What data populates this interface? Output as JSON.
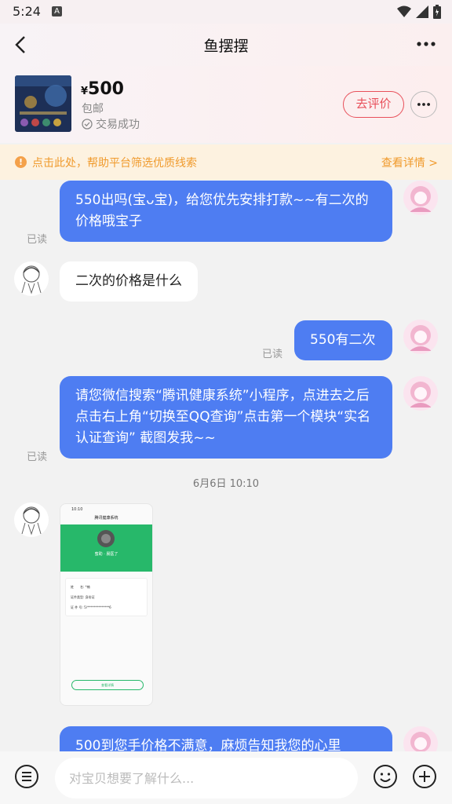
{
  "status": {
    "time": "5:24",
    "notif": "A"
  },
  "header": {
    "title": "鱼摆摆"
  },
  "product": {
    "currency": "¥",
    "price": "500",
    "shipping": "包邮",
    "deal_status": "交易成功",
    "rate_label": "去评价"
  },
  "tip": {
    "text": "点击此处，帮助平台筛选优质线索",
    "link": "查看详情 >"
  },
  "messages": [
    {
      "side": "out",
      "text": "550出吗(宝ᴗ宝)，给您优先安排打款~~有二次的价格哦宝子",
      "read": "已读"
    },
    {
      "side": "in",
      "text": "二次的价格是什么"
    },
    {
      "side": "out",
      "text": "550有二次",
      "read": "已读"
    },
    {
      "side": "out",
      "text": "请您微信搜索“腾讯健康系统”小程序，点进去之后点击右上角“切换至QQ查询”点击第一个模块“实名认证查询” 截图发我~~",
      "read": "已读"
    },
    {
      "side": "out",
      "text": "500到您手价格不满意，麻烦告知我您的心里"
    }
  ],
  "timestamp": "6月6日 10:10",
  "screenshot": {
    "time": "10:10",
    "title": "腾讯健康系统",
    "name_line": "蜜助 · 晨医了",
    "rows": [
      {
        "k": "姓　　名:",
        "v": "*楠"
      },
      {
        "k": "证件类型:",
        "v": "身份证"
      },
      {
        "k": "证 件 号:",
        "v": "5/**************6"
      }
    ],
    "button": "查看详情"
  },
  "composer": {
    "placeholder": "对宝贝想要了解什么..."
  },
  "colors": {
    "bubble_out": "#4e7df2",
    "accent": "#e8505b",
    "tip": "#f09a2c"
  }
}
